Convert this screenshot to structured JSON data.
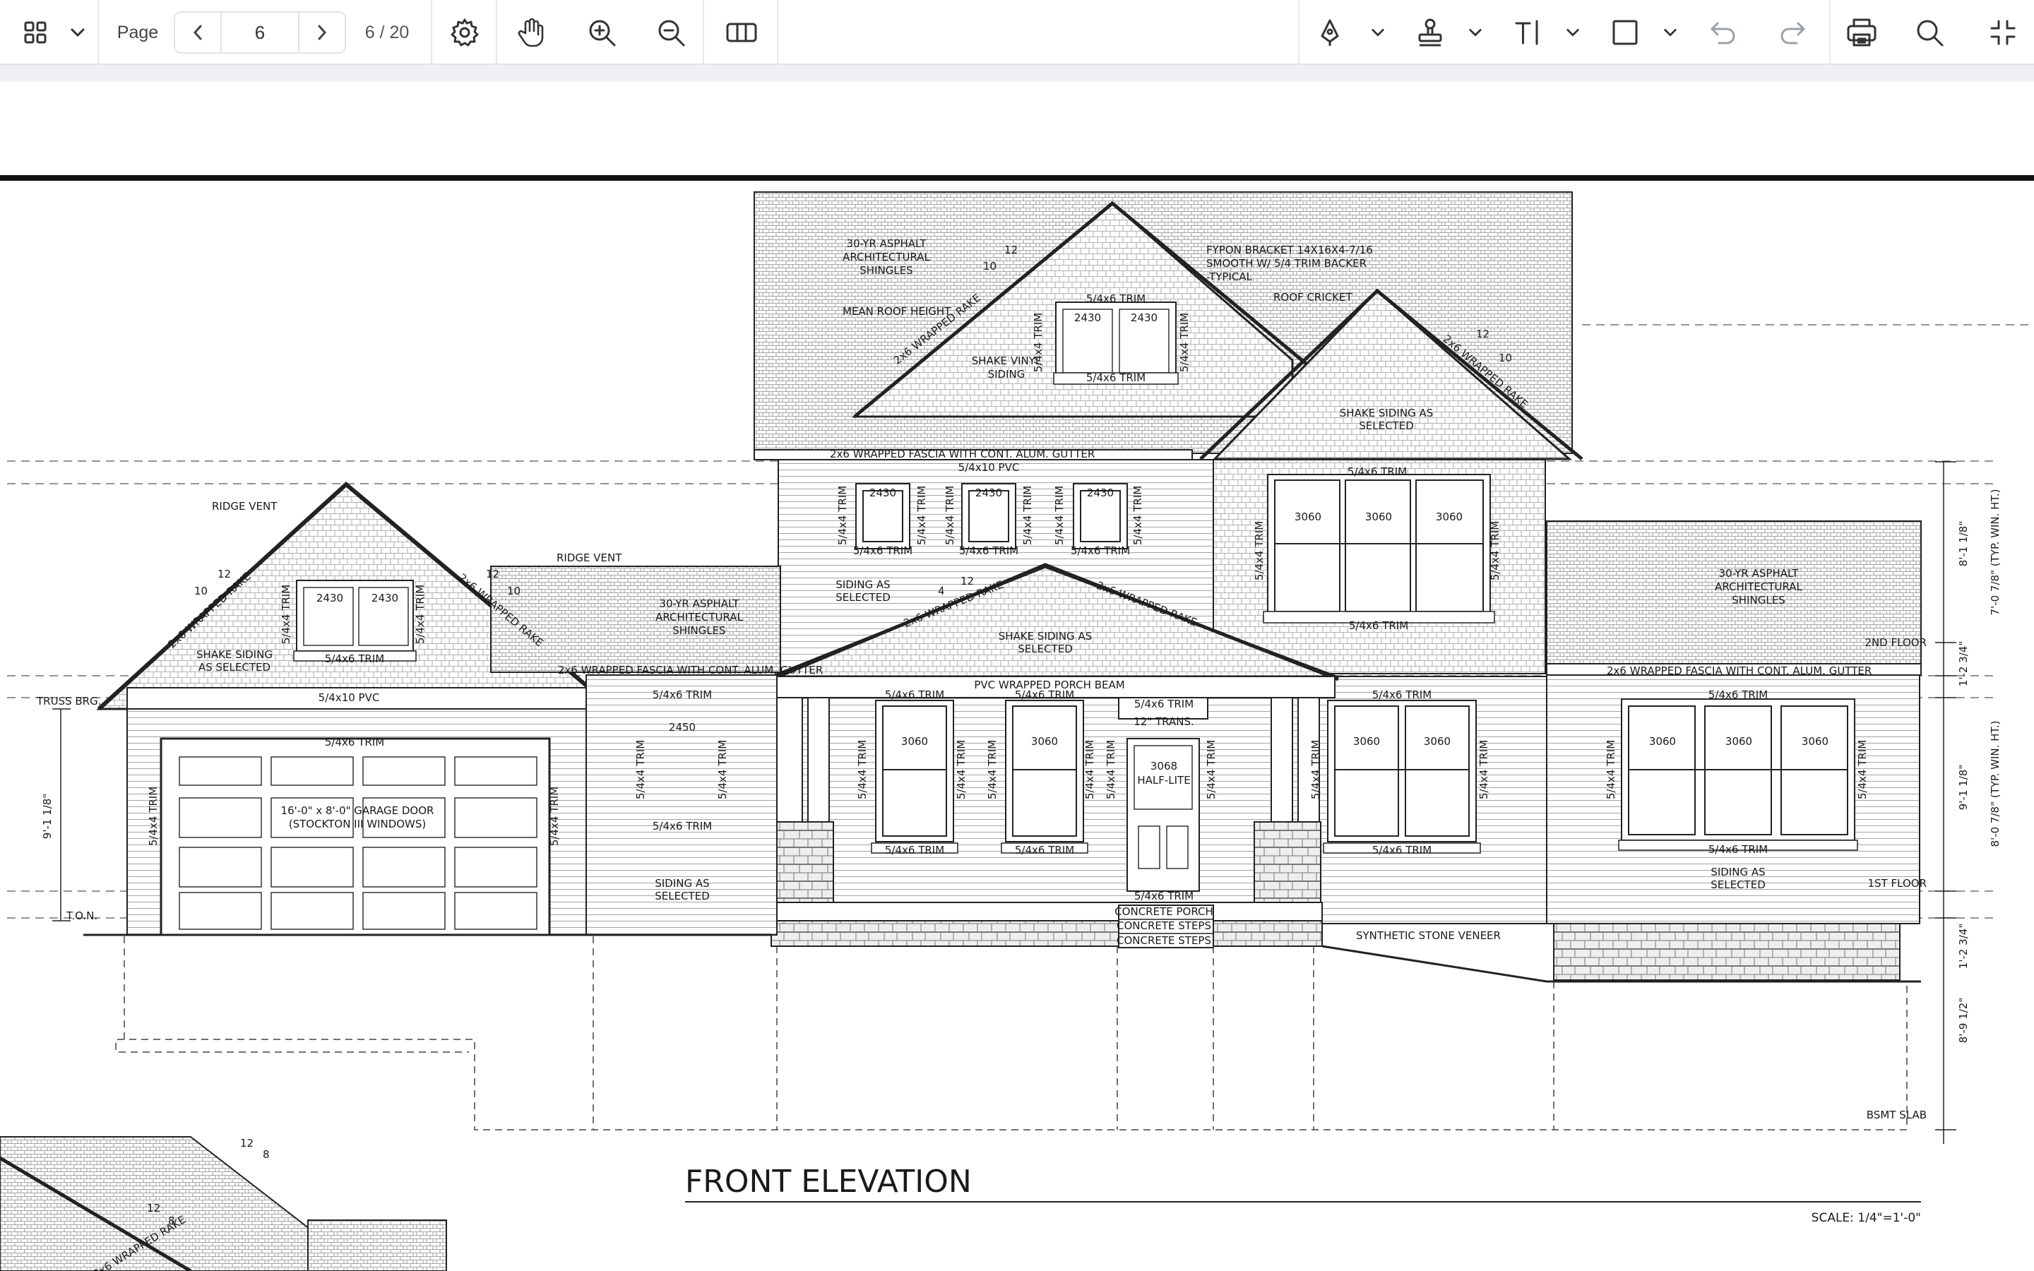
{
  "toolbar": {
    "icons": [
      "grid-view-icon",
      "chevron-down-icon",
      "chevron-left-icon",
      "chevron-right-icon",
      "gear-icon",
      "hand-pan-icon",
      "zoom-in-icon",
      "zoom-out-icon",
      "two-page-view-icon",
      "pen-icon",
      "stamp-icon",
      "text-tool-icon",
      "rectangle-icon",
      "undo-icon",
      "redo-icon",
      "print-icon",
      "search-icon",
      "collapse-icon"
    ],
    "page_label": "Page",
    "current_page": "6",
    "page_count": "6 / 20"
  },
  "drawing": {
    "title": "FRONT ELEVATION",
    "scale": "SCALE: 1/4\"=1'-0\"",
    "labels": {
      "roof_upper": [
        "30-YR ASPHALT",
        "ARCHITECTURAL",
        "SHINGLES"
      ],
      "pitch_12": "12",
      "pitch_10": "10",
      "pitch_4": "4",
      "pitch_8": "8",
      "bracket": [
        "FYPON BRACKET 14X16X4-7/16",
        "SMOOTH W/ 5/4 TRIM BACKER",
        "-TYPICAL"
      ],
      "mean_roof": "MEAN ROOF HEIGHT",
      "roof_cricket": "ROOF CRICKET",
      "trim_546": "5/4x6 TRIM",
      "trim_544": "5/4x4 TRIM",
      "pvc_5410": "5/4x10 PVC",
      "win_2430": "2430",
      "win_2450": "2450",
      "win_3060": "3060",
      "shake_vinyl": [
        "SHAKE VINYL",
        "SIDING"
      ],
      "shake_selected": [
        "SHAKE SIDING AS",
        "SELECTED"
      ],
      "shake_selected2": [
        "SHAKE SIDING",
        "AS SELECTED"
      ],
      "wrapped_rake": "2x6 WRAPPED RAKE",
      "fascia": "2x6 WRAPPED FASCIA WITH CONT. ALUM. GUTTER",
      "ridge_vent": "RIDGE VENT",
      "truss_brg": "TRUSS BRG.",
      "ton": "T.O.N.",
      "garage_door": [
        "16'-0\" x 8'-0\" GARAGE DOOR",
        "(STOCKTON III WINDOWS)"
      ],
      "siding_selected": [
        "SIDING AS",
        "SELECTED"
      ],
      "porch_beam": "PVC WRAPPED PORCH BEAM",
      "transom": "12\" TRANS.",
      "door": [
        "3068",
        "HALF-LITE"
      ],
      "concrete_porch": "CONCRETE PORCH",
      "concrete_steps": "CONCRETE STEPS",
      "stone_veneer": "SYNTHETIC STONE VENEER",
      "floor2": "2ND FLOOR",
      "floor1": "1ST FLOOR",
      "bsmt": "BSMT SLAB",
      "dim_top": "8'-1 1/8\"",
      "dim_win2": "7'-0 7/8\" (TYP. WIN. HT.)",
      "dim_mid": "1'-2 3/4\"",
      "dim_win1": "8'-0 7/8\" (TYP. WIN. HT.)",
      "dim_first": "9'-1 1/8\"",
      "dim_low": "1'-2 3/4\"",
      "dim_bsmt": "8'-9 1/2\"",
      "dim_garage": "9'-1 1/8\""
    }
  }
}
